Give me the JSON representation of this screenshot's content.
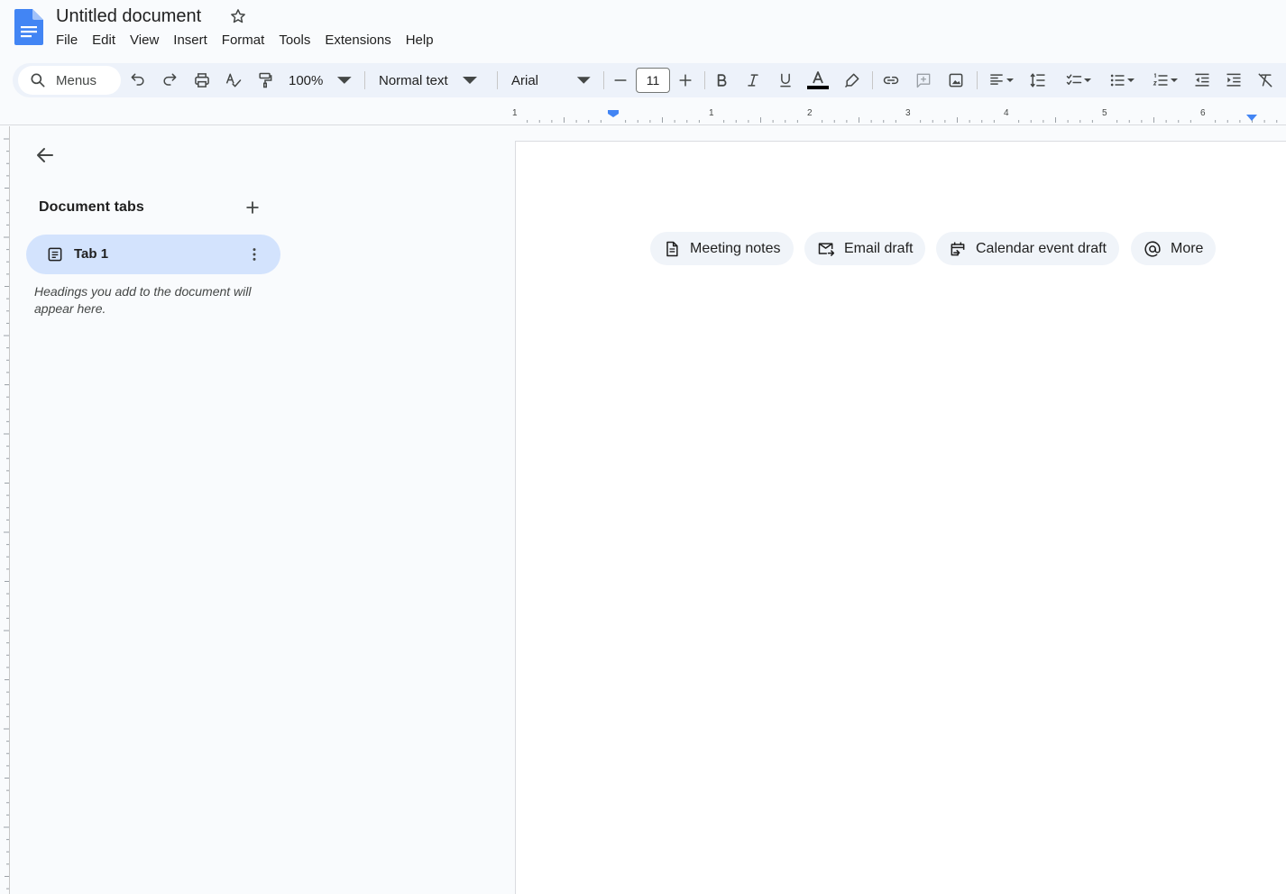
{
  "app": {
    "title": "Untitled document"
  },
  "menubar": {
    "items": [
      "File",
      "Edit",
      "View",
      "Insert",
      "Format",
      "Tools",
      "Extensions",
      "Help"
    ]
  },
  "toolbar": {
    "search_label": "Menus",
    "zoom": "100%",
    "paragraph_style": "Normal text",
    "font_family": "Arial",
    "font_size": "11",
    "text_color": "#000000",
    "accent_color": "#4285f4"
  },
  "ruler": {
    "numbers": [
      "1",
      "1",
      "2",
      "3",
      "4",
      "5",
      "6"
    ]
  },
  "sidebar": {
    "title": "Document tabs",
    "tab_label": "Tab 1",
    "hint": "Headings you add to the document will appear here."
  },
  "chips": [
    {
      "label": "Meeting notes",
      "icon": "document-icon"
    },
    {
      "label": "Email draft",
      "icon": "email-icon"
    },
    {
      "label": "Calendar event draft",
      "icon": "calendar-icon"
    },
    {
      "label": "More",
      "icon": "at-sign-icon"
    }
  ]
}
